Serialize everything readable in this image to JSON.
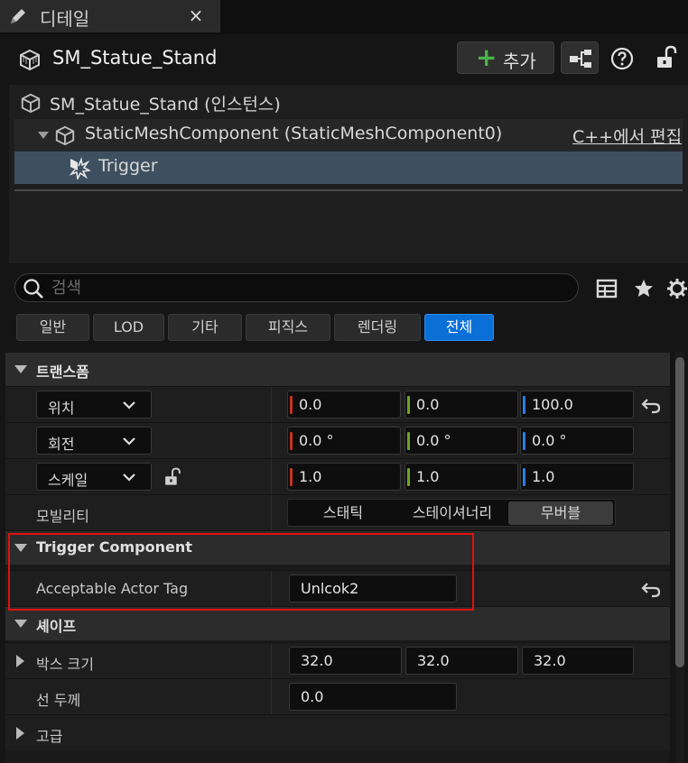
{
  "tab": {
    "label": "디테일",
    "close": "×"
  },
  "header": {
    "title": "SM_Statue_Stand",
    "add_label": "추가"
  },
  "tree": {
    "actor": "SM_Statue_Stand (인스턴스)",
    "component": "StaticMeshComponent (StaticMeshComponent0)",
    "edit_link": "C++에서 편집",
    "child": "Trigger"
  },
  "search": {
    "placeholder": "검색"
  },
  "categories": [
    "일반",
    "LOD",
    "기타",
    "피직스",
    "렌더링",
    "전체"
  ],
  "active_category": "전체",
  "transform": {
    "section": "트랜스폼",
    "location": {
      "label": "위치",
      "x": "0.0",
      "y": "0.0",
      "z": "100.0"
    },
    "rotation": {
      "label": "회전",
      "x": "0.0 °",
      "y": "0.0 °",
      "z": "0.0 °"
    },
    "scale": {
      "label": "스케일",
      "x": "1.0",
      "y": "1.0",
      "z": "1.0"
    },
    "mobility": {
      "label": "모빌리티",
      "options": [
        "스태틱",
        "스테이셔너리",
        "무버블"
      ],
      "selected": "무버블"
    }
  },
  "trigger": {
    "section": "Trigger Component",
    "tag_label": "Acceptable Actor Tag",
    "tag_value": "Unlcok2"
  },
  "shape": {
    "section": "셰이프",
    "box_label": "박스 크기",
    "box": [
      "32.0",
      "32.0",
      "32.0"
    ],
    "line_label": "선 두께",
    "line_value": "0.0"
  },
  "advanced": {
    "label": "고급"
  },
  "colors": {
    "x_axis": "#c8321e",
    "y_axis": "#6fa51e",
    "z_axis": "#2d7de6",
    "accent": "#0a6fd6",
    "highlight": "#e01010"
  }
}
